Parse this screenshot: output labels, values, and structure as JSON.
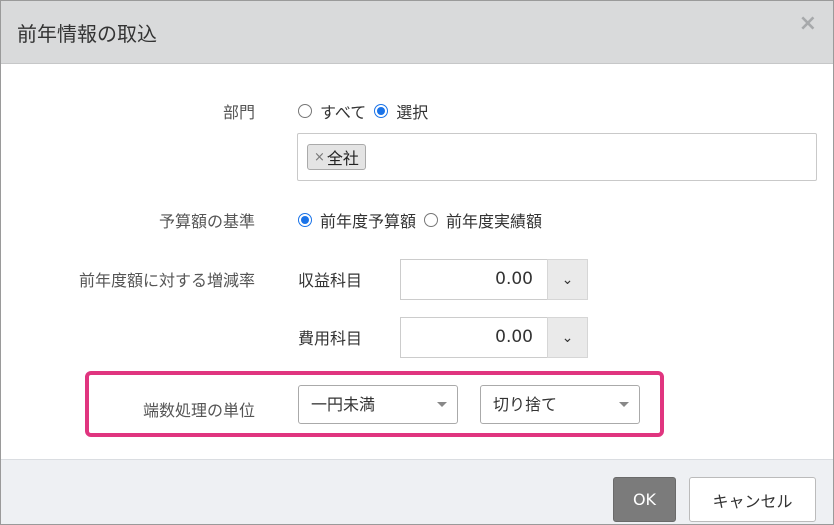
{
  "dialog": {
    "title": "前年情報の取込",
    "close_label": "×"
  },
  "department": {
    "label": "部門",
    "options": [
      "すべて",
      "選択"
    ],
    "selected": "選択",
    "tags": [
      "全社"
    ],
    "tag_remove": "×"
  },
  "budget_basis": {
    "label": "予算額の基準",
    "options": [
      "前年度予算額",
      "前年度実績額"
    ],
    "selected": "前年度予算額"
  },
  "rate": {
    "label": "前年度額に対する増減率",
    "revenue_label": "収益科目",
    "revenue_value": "0.00",
    "expense_label": "費用科目",
    "expense_value": "0.00",
    "chevron": "⌄"
  },
  "rounding": {
    "label": "端数処理の単位",
    "unit_value": "一円未満",
    "method_value": "切り捨て",
    "highlight_color": "#e0357f"
  },
  "footer": {
    "ok_label": "OK",
    "cancel_label": "キャンセル"
  },
  "colors": {
    "header_bg": "#d9dadb",
    "accent": "#1a73e8",
    "ok_bg": "#7b7b7b"
  }
}
